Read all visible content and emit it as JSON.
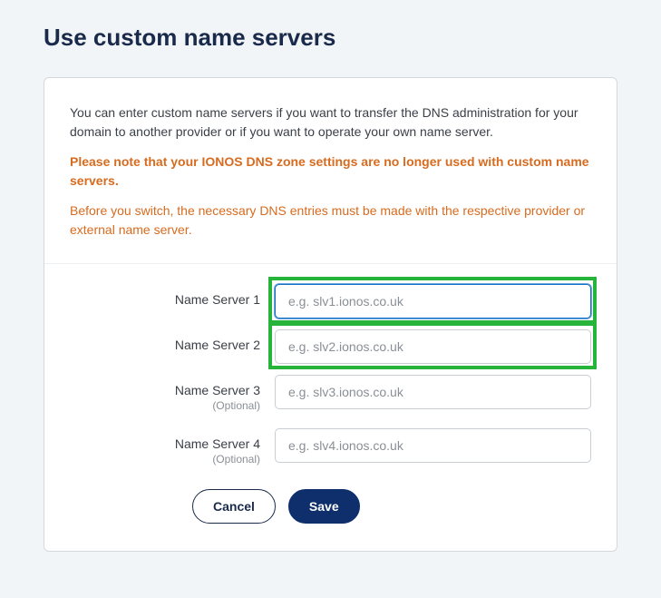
{
  "page": {
    "title": "Use custom name servers"
  },
  "intro": {
    "text": "You can enter custom name servers if you want to transfer the DNS administration for your domain to another provider or if you want to operate your own name server.",
    "warning": "Please note that your IONOS DNS zone settings are no longer used with custom name servers.",
    "note": "Before you switch, the necessary DNS entries must be made with the respective provider or external name server."
  },
  "form": {
    "optional_label": "(Optional)",
    "ns1": {
      "label": "Name Server 1",
      "placeholder": "e.g. slv1.ionos.co.uk",
      "value": ""
    },
    "ns2": {
      "label": "Name Server 2",
      "placeholder": "e.g. slv2.ionos.co.uk",
      "value": ""
    },
    "ns3": {
      "label": "Name Server 3",
      "placeholder": "e.g. slv3.ionos.co.uk",
      "value": ""
    },
    "ns4": {
      "label": "Name Server 4",
      "placeholder": "e.g. slv4.ionos.co.uk",
      "value": ""
    }
  },
  "actions": {
    "cancel": "Cancel",
    "save": "Save"
  },
  "colors": {
    "accent_orange": "#d76b1f",
    "primary_dark": "#0e2f6c",
    "highlight_green": "#27b43b",
    "focus_blue": "#1472c4"
  }
}
